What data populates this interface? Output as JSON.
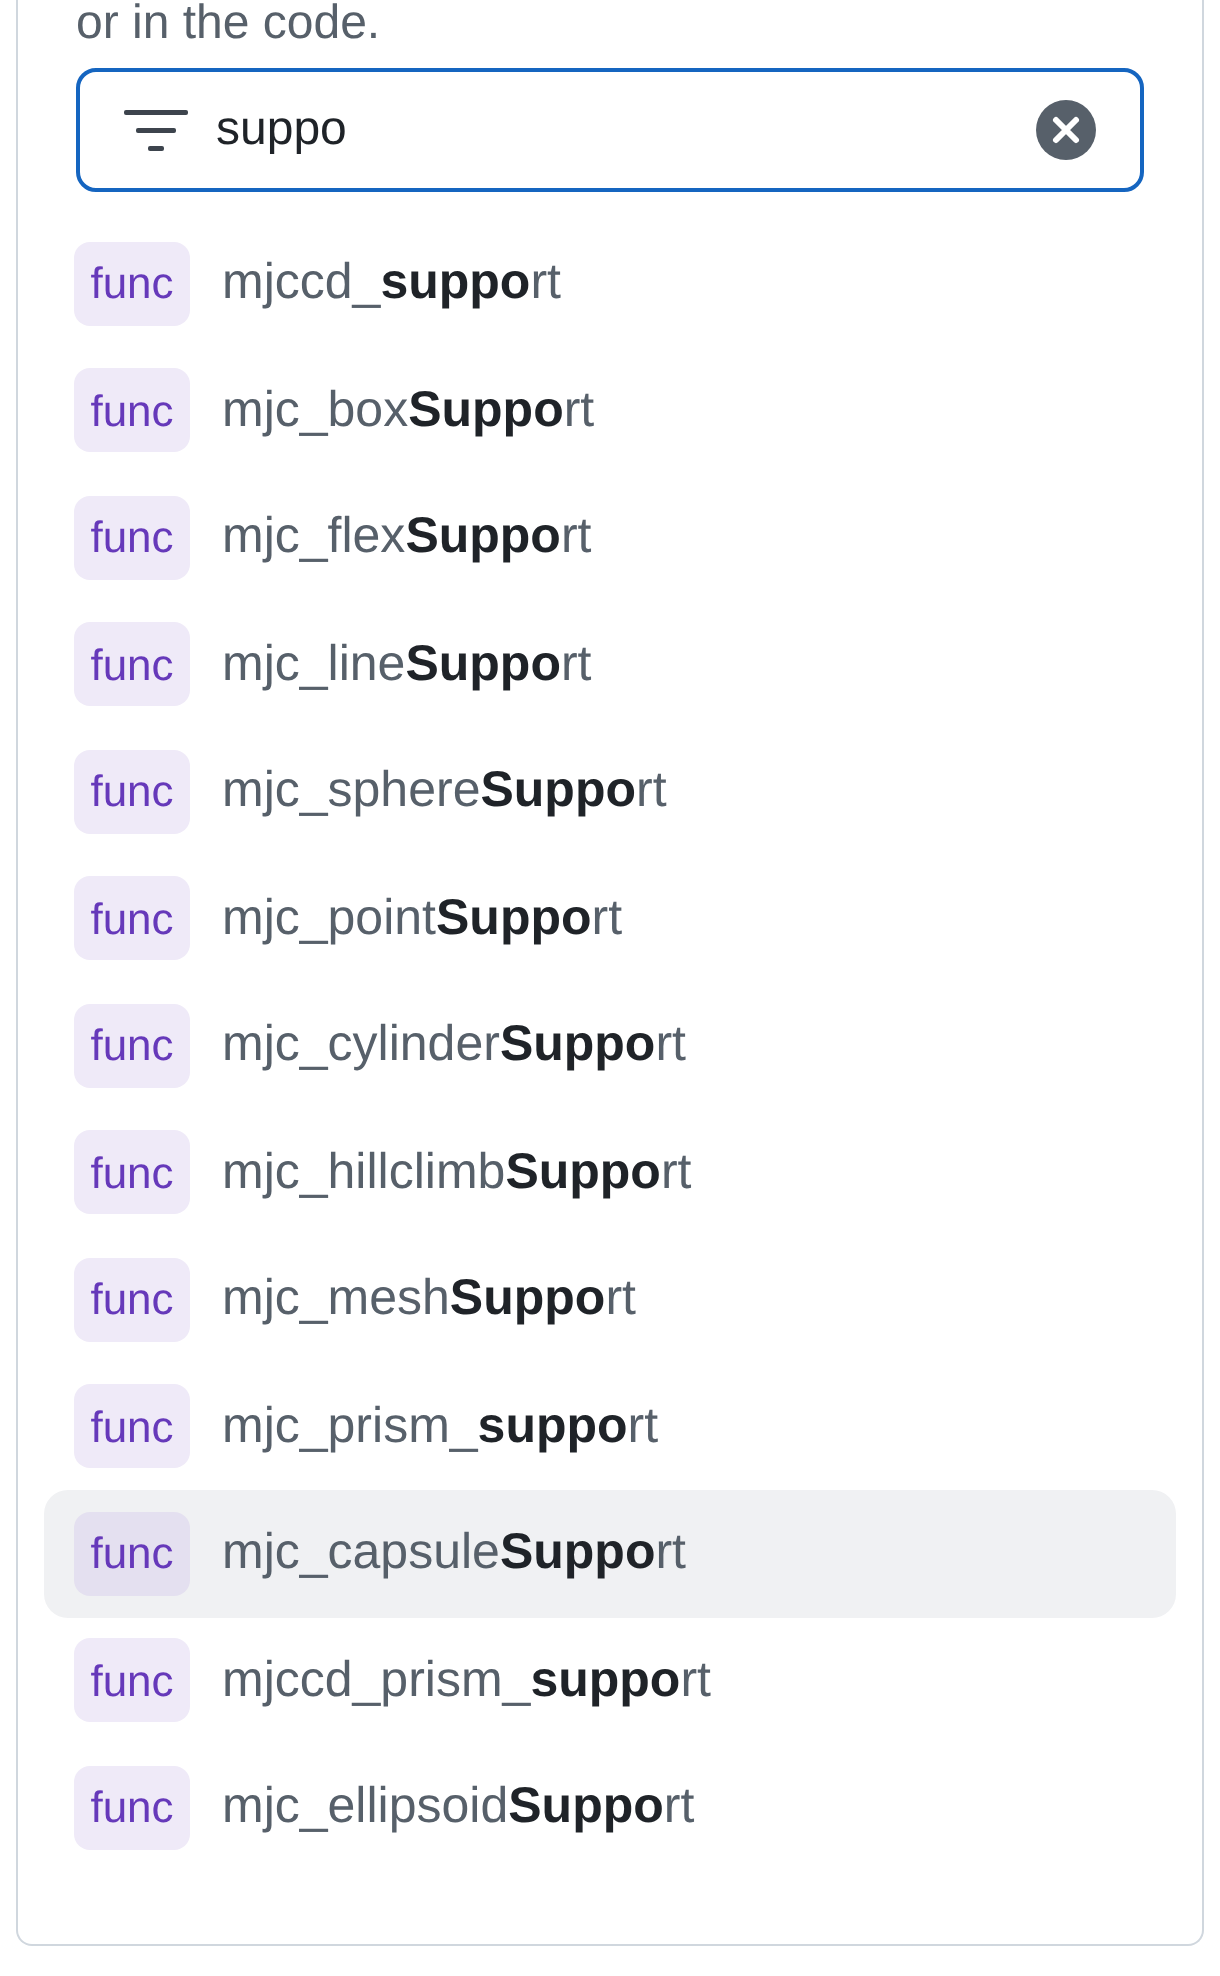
{
  "intro_text": "or in the code.",
  "search": {
    "value": "suppo"
  },
  "results": [
    {
      "badge": "func",
      "name": "mjccd_**suppo**rt",
      "selected": false
    },
    {
      "badge": "func",
      "name": "mjc_box**Suppo**rt",
      "selected": false
    },
    {
      "badge": "func",
      "name": "mjc_flex**Suppo**rt",
      "selected": false
    },
    {
      "badge": "func",
      "name": "mjc_line**Suppo**rt",
      "selected": false
    },
    {
      "badge": "func",
      "name": "mjc_sphere**Suppo**rt",
      "selected": false
    },
    {
      "badge": "func",
      "name": "mjc_point**Suppo**rt",
      "selected": false
    },
    {
      "badge": "func",
      "name": "mjc_cylinder**Suppo**rt",
      "selected": false
    },
    {
      "badge": "func",
      "name": "mjc_hillclimb**Suppo**rt",
      "selected": false
    },
    {
      "badge": "func",
      "name": "mjc_mesh**Suppo**rt",
      "selected": false
    },
    {
      "badge": "func",
      "name": "mjc_prism_**suppo**rt",
      "selected": false
    },
    {
      "badge": "func",
      "name": "mjc_capsule**Suppo**rt",
      "selected": true
    },
    {
      "badge": "func",
      "name": "mjccd_prism_**suppo**rt",
      "selected": false
    },
    {
      "badge": "func",
      "name": "mjc_ellipsoid**Suppo**rt",
      "selected": false
    }
  ]
}
